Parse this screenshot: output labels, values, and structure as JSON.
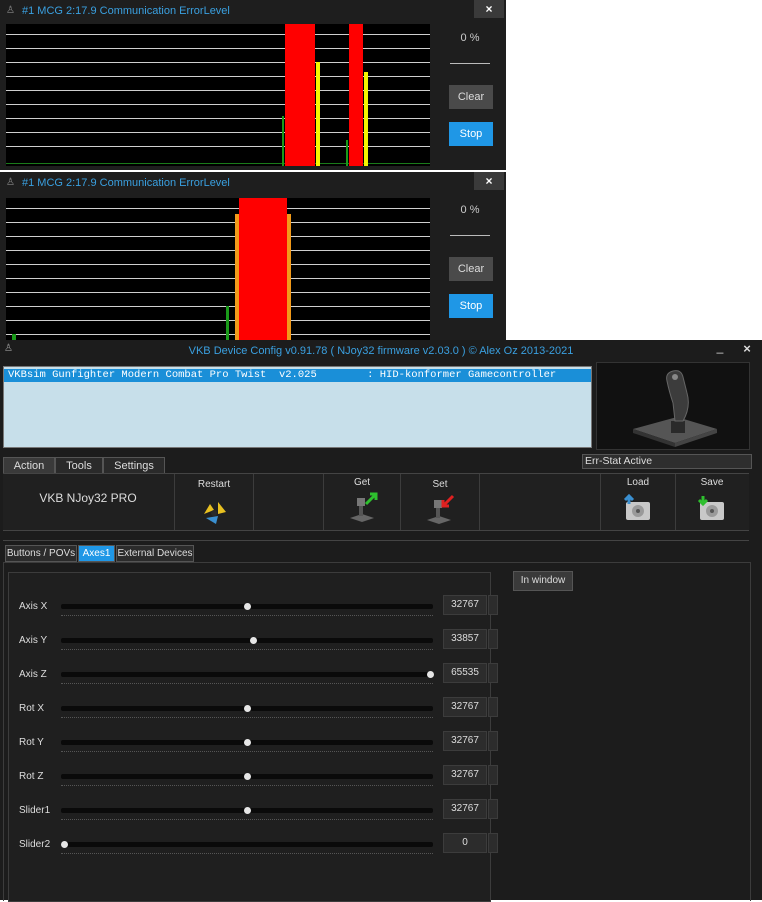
{
  "error_windows": [
    {
      "title": "#1 MCG  2:17.9  Communication ErrorLevel",
      "close_label": "×",
      "percent": "0 %",
      "clear_label": "Clear",
      "stop_label": "Stop"
    },
    {
      "title": "#1 MCG  2:17.9  Communication ErrorLevel",
      "close_label": "×",
      "percent": "0 %",
      "clear_label": "Clear",
      "stop_label": "Stop"
    }
  ],
  "main": {
    "title": "VKB Device Config v0.91.78 ( NJoy32 firmware v2.03.0 ) © Alex Oz 2013-2021",
    "minimize_label": "_",
    "close_label": "×",
    "device_row": "VKBsim Gunfighter Modern Combat Pro Twist  v2.025        : HID-konformer Gamecontroller",
    "tabs": [
      "Action",
      "Tools",
      "Settings"
    ],
    "err_stat": "Err-Stat Active",
    "toolbar": {
      "device_name": "VKB NJoy32 PRO",
      "restart": "Restart",
      "get": "Get",
      "set": "Set",
      "load": "Load",
      "save": "Save"
    },
    "subtabs": [
      "Buttons / POVs",
      "Axes1",
      "External Devices"
    ],
    "in_window": "In window",
    "axes": [
      {
        "label": "Axis X",
        "value": "32767",
        "level": 0.5
      },
      {
        "label": "Axis Y",
        "value": "33857",
        "level": 0.517
      },
      {
        "label": "Axis Z",
        "value": "65535",
        "level": 1.0
      },
      {
        "label": "Rot X",
        "value": "32767",
        "level": 0.5
      },
      {
        "label": "Rot Y",
        "value": "32767",
        "level": 0.5
      },
      {
        "label": "Rot Z",
        "value": "32767",
        "level": 0.5
      },
      {
        "label": "Slider1",
        "value": "32767",
        "level": 0.5
      },
      {
        "label": "Slider2",
        "value": "0",
        "level": 0.0
      }
    ]
  },
  "colors": {
    "accent_blue": "#1f97e6",
    "title_blue": "#3aa0e0",
    "error_red": "#ff0000",
    "error_yellow": "#f5f500",
    "error_orange": "#f29a1a",
    "error_green": "#1a9a1a"
  }
}
